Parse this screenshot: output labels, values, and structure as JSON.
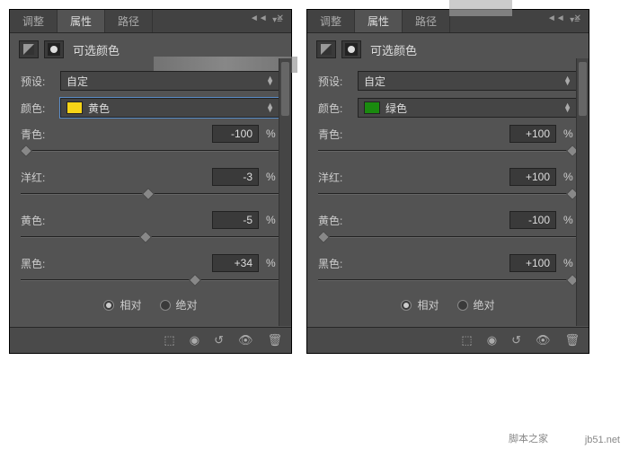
{
  "tabs": {
    "adjust": "调整",
    "properties": "属性",
    "paths": "路径"
  },
  "title": "可选颜色",
  "preset_label": "预设:",
  "preset_value": "自定",
  "color_label": "颜色:",
  "percent": "%",
  "sliders": {
    "cyan": "青色:",
    "magenta": "洋红:",
    "yellow": "黄色:",
    "black": "黑色:"
  },
  "radios": {
    "relative": "相对",
    "absolute": "绝对"
  },
  "left": {
    "color_name": "黄色",
    "swatch": "#f7d417",
    "values": {
      "cyan": "-100",
      "magenta": "-3",
      "yellow": "-5",
      "black": "+34"
    },
    "thumb_pos": {
      "cyan": 2,
      "magenta": 49,
      "yellow": 48,
      "black": 67
    }
  },
  "right": {
    "color_name": "绿色",
    "swatch": "#1a8a0f",
    "values": {
      "cyan": "+100",
      "magenta": "+100",
      "yellow": "-100",
      "black": "+100"
    },
    "thumb_pos": {
      "cyan": 98,
      "magenta": 98,
      "yellow": 2,
      "black": 98
    }
  },
  "watermark": {
    "site": "jb51.net",
    "name": "脚本之家"
  }
}
